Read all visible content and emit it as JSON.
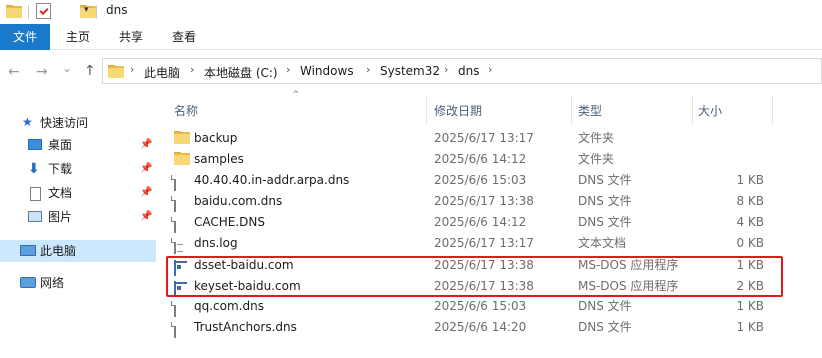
{
  "window": {
    "title": "dns",
    "qa_dropdown": "▾"
  },
  "ribbon": {
    "tabs": [
      "文件",
      "主页",
      "共享",
      "查看"
    ]
  },
  "nav": {
    "back": "←",
    "forward": "→",
    "dropdown": "⌄",
    "up": "↑"
  },
  "breadcrumb": [
    "此电脑",
    "本地磁盘 (C:)",
    "Windows",
    "System32",
    "dns"
  ],
  "sidebar": {
    "quick_access": "快速访问",
    "items": [
      {
        "label": "桌面",
        "icon": "desktop-icon"
      },
      {
        "label": "下载",
        "icon": "download-icon"
      },
      {
        "label": "文档",
        "icon": "documents-icon"
      },
      {
        "label": "图片",
        "icon": "pictures-icon"
      }
    ],
    "this_pc": "此电脑",
    "network": "网络"
  },
  "columns": {
    "name": "名称",
    "modified": "修改日期",
    "type": "类型",
    "size": "大小"
  },
  "files": [
    {
      "name": "backup",
      "modified": "2025/6/17 13:17",
      "type": "文件夹",
      "size": "",
      "icon": "folder-icon"
    },
    {
      "name": "samples",
      "modified": "2025/6/6 14:12",
      "type": "文件夹",
      "size": "",
      "icon": "folder-icon"
    },
    {
      "name": "40.40.40.in-addr.arpa.dns",
      "modified": "2025/6/6 15:03",
      "type": "DNS 文件",
      "size": "1 KB",
      "icon": "file-icon"
    },
    {
      "name": "baidu.com.dns",
      "modified": "2025/6/17 13:38",
      "type": "DNS 文件",
      "size": "8 KB",
      "icon": "file-icon"
    },
    {
      "name": "CACHE.DNS",
      "modified": "2025/6/6 14:12",
      "type": "DNS 文件",
      "size": "4 KB",
      "icon": "file-icon"
    },
    {
      "name": "dns.log",
      "modified": "2025/6/17 13:17",
      "type": "文本文档",
      "size": "0 KB",
      "icon": "text-file-icon"
    },
    {
      "name": "dsset-baidu.com",
      "modified": "2025/6/17 13:38",
      "type": "MS-DOS 应用程序",
      "size": "1 KB",
      "icon": "application-icon"
    },
    {
      "name": "keyset-baidu.com",
      "modified": "2025/6/17 13:38",
      "type": "MS-DOS 应用程序",
      "size": "2 KB",
      "icon": "application-icon"
    },
    {
      "name": "qq.com.dns",
      "modified": "2025/6/6 15:03",
      "type": "DNS 文件",
      "size": "1 KB",
      "icon": "file-icon"
    },
    {
      "name": "TrustAnchors.dns",
      "modified": "2025/6/6 14:20",
      "type": "DNS 文件",
      "size": "1 KB",
      "icon": "file-icon"
    }
  ],
  "colors": {
    "accent": "#1979ca",
    "selection": "#cce8ff",
    "highlight_box": "#e01b1b",
    "folder": "#f8d775"
  }
}
